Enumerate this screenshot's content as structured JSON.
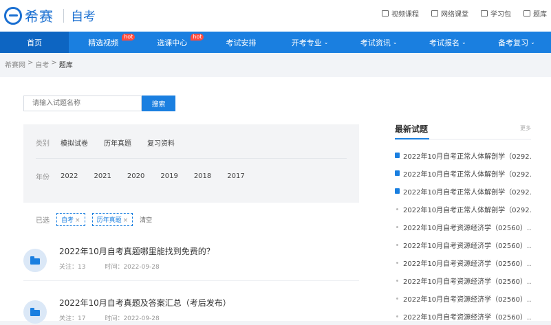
{
  "header": {
    "logo_text": "希赛",
    "logo_sub": "自考",
    "links": [
      {
        "label": "视频课程",
        "icon": "video-icon"
      },
      {
        "label": "网络课堂",
        "icon": "monitor-icon"
      },
      {
        "label": "学习包",
        "icon": "package-icon"
      },
      {
        "label": "题库",
        "icon": "book-icon"
      }
    ]
  },
  "nav": {
    "items": [
      {
        "label": "首页"
      },
      {
        "label": "精选视频",
        "badge": "hot"
      },
      {
        "label": "选课中心",
        "badge": "hot"
      },
      {
        "label": "考试安排"
      },
      {
        "label": "开考专业",
        "dropdown": "⌄"
      },
      {
        "label": "考试资讯",
        "dropdown": "⌄"
      },
      {
        "label": "考试报名",
        "dropdown": "⌄"
      },
      {
        "label": "备考复习",
        "dropdown": "⌄"
      }
    ]
  },
  "breadcrumb": {
    "items": [
      "希赛网",
      ">",
      "自考",
      ">",
      "题库"
    ]
  },
  "search": {
    "placeholder": "请输入试题名称",
    "button": "搜索"
  },
  "filter": {
    "category_label": "类别",
    "categories": [
      "模拟试卷",
      "历年真题",
      "复习资料"
    ],
    "year_label": "年份",
    "years": [
      "2022",
      "2021",
      "2020",
      "2019",
      "2018",
      "2017"
    ]
  },
  "selected": {
    "label": "已选",
    "tags": [
      "自考",
      "历年真题"
    ],
    "remove_symbol": "×",
    "clear": "清空"
  },
  "articles": [
    {
      "title": "2022年10月自考真题哪里能找到免费的？",
      "follow": "关注：13",
      "time": "时间：2022-09-28"
    },
    {
      "title": "2022年10月自考真题及答案汇总（考后发布）",
      "follow": "关注：17",
      "time": "时间：2022-09-28"
    }
  ],
  "sidebar": {
    "title": "最新试题",
    "more": "更多",
    "items": [
      {
        "text": "2022年10月自考正常人体解剖学（0292...",
        "icon": "doc-icon"
      },
      {
        "text": "2022年10月自考正常人体解剖学（0292...",
        "icon": "doc-icon"
      },
      {
        "text": "2022年10月自考正常人体解剖学（0292...",
        "icon": "doc-icon"
      },
      {
        "text": "2022年10月自考正常人体解剖学（0292...",
        "icon": "dot"
      },
      {
        "text": "2022年10月自考资源经济学（02560）...",
        "icon": "dot"
      },
      {
        "text": "2022年10月自考资源经济学（02560）...",
        "icon": "dot"
      },
      {
        "text": "2022年10月自考资源经济学（02560）...",
        "icon": "dot"
      },
      {
        "text": "2022年10月自考资源经济学（02560）...",
        "icon": "dot"
      },
      {
        "text": "2022年10月自考资源经济学（02560）...",
        "icon": "dot"
      },
      {
        "text": "2022年10月自考资源经济学（02560）...",
        "icon": "dot"
      }
    ]
  },
  "colors": {
    "brand": "#1a7fe0",
    "nav_active": "#0d65c2",
    "hot_badge": "#ff4b3e"
  }
}
